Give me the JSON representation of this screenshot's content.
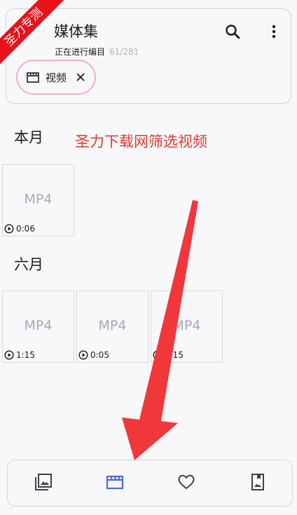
{
  "header": {
    "title": "媒体集",
    "subtitle": "正在进行编目",
    "progress": "61/281"
  },
  "filter_chip": {
    "label": "视频"
  },
  "overlay": {
    "ribbon_text": "圣力专测",
    "annotation": "圣力下载网筛选视频"
  },
  "sections": [
    {
      "label": "本月",
      "items": [
        {
          "type": "MP4",
          "duration": "0:06"
        }
      ]
    },
    {
      "label": "六月",
      "items": [
        {
          "type": "MP4",
          "duration": "1:15"
        },
        {
          "type": "MP4",
          "duration": "0:05"
        },
        {
          "type": "MP4",
          "duration": "1:15"
        }
      ]
    }
  ],
  "colors": {
    "accent": "#4f6bd8",
    "annotation": "#e03a2e",
    "ribbon": "#e8121a"
  }
}
